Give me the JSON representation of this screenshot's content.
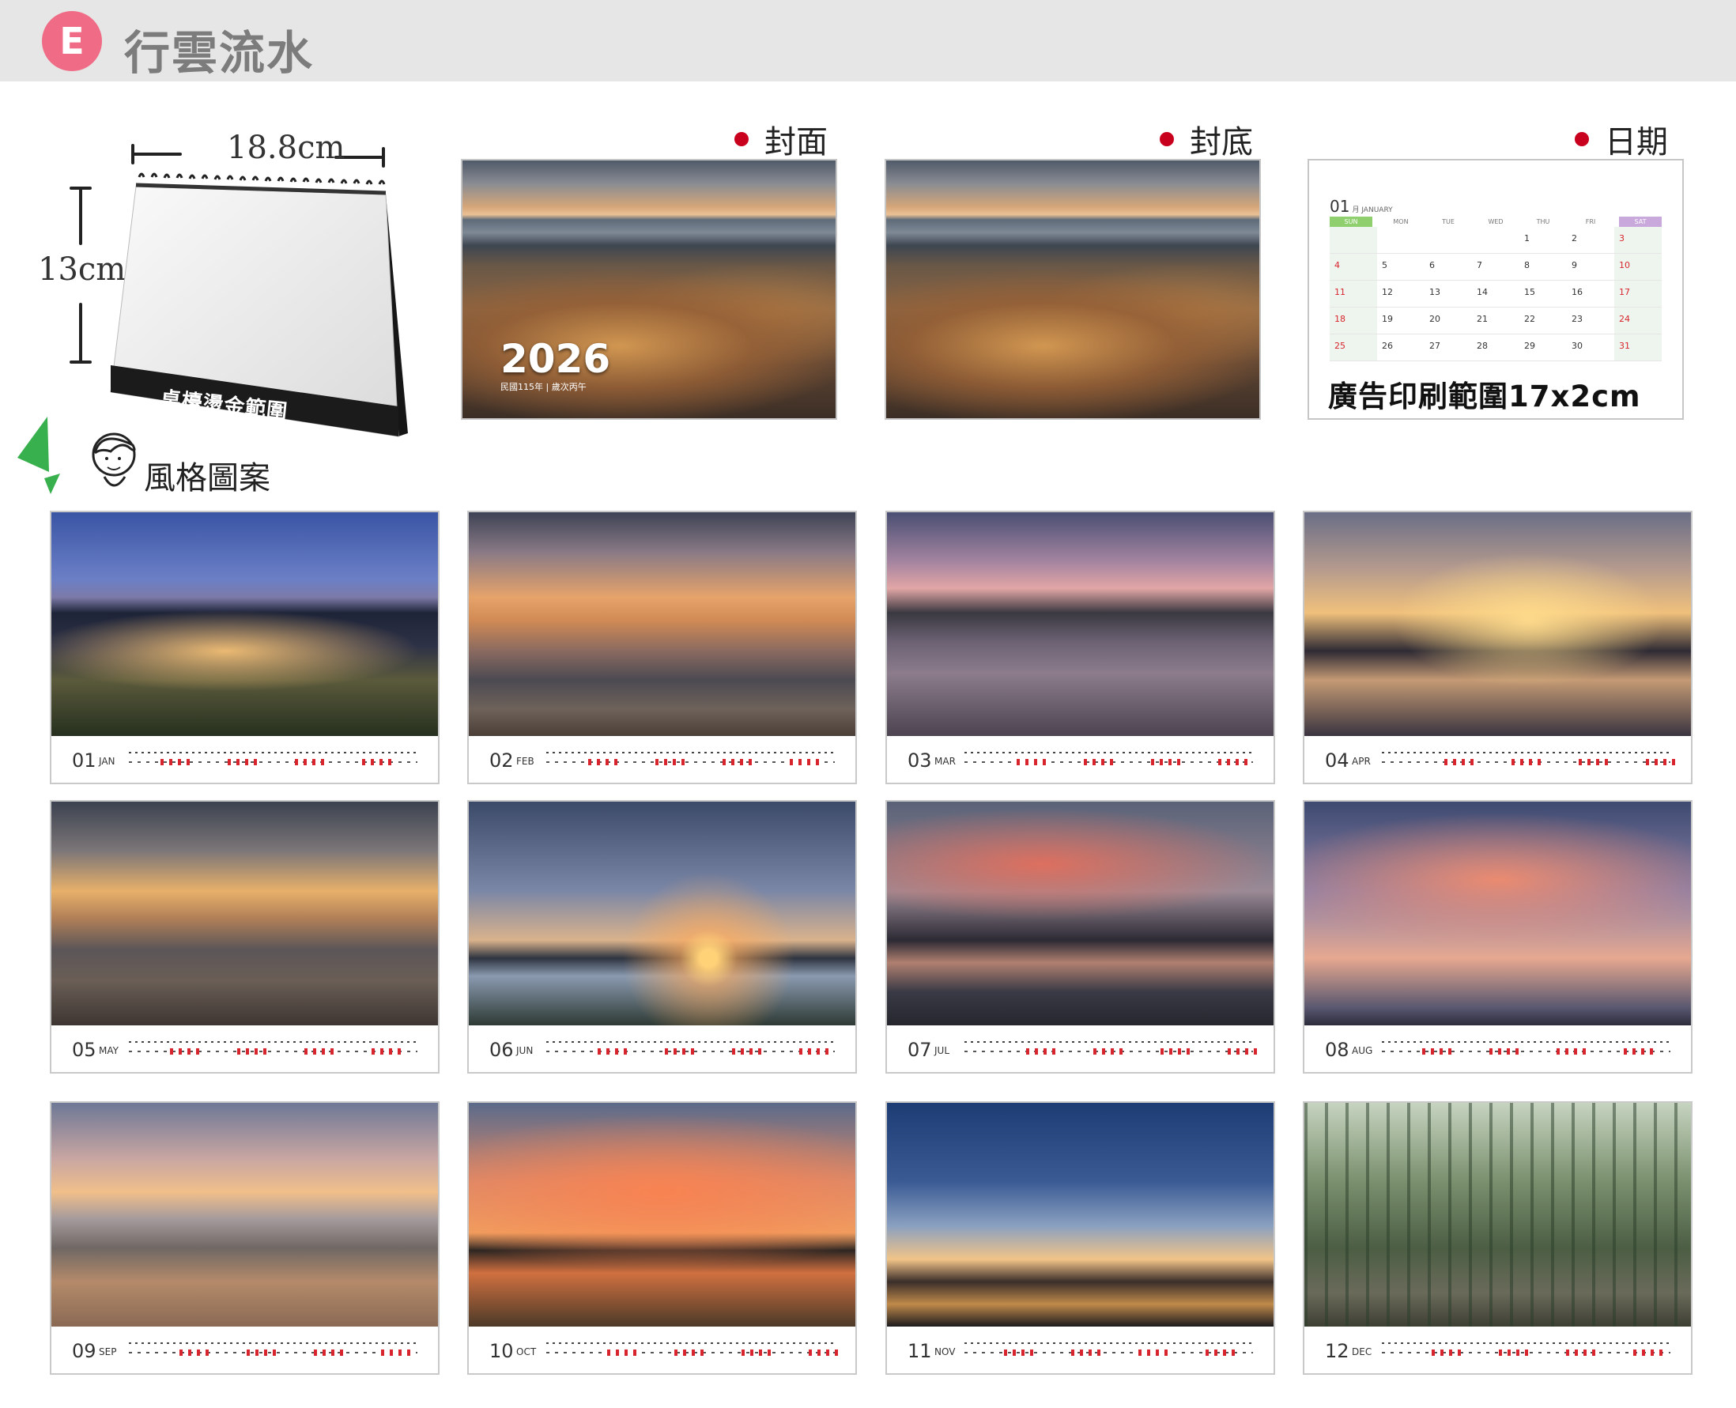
{
  "header": {
    "badge": "E",
    "title": "行雲流水"
  },
  "product": {
    "width_label": "18.8cm",
    "height_label": "13cm",
    "foil_area_label": "桌檯燙金範圍",
    "style_label": "風格圖案"
  },
  "panels": {
    "cover_label": "封面",
    "back_label": "封底",
    "date_label": "日期",
    "cover_year": "2026",
    "cover_sub": "民國115年 | 歲次丙午"
  },
  "date_page": {
    "month": "01",
    "month_name": "月 JANUARY",
    "weekdays": [
      "SUN",
      "MON",
      "TUE",
      "WED",
      "THU",
      "FRI",
      "SAT"
    ],
    "days": [
      [
        "",
        "",
        "",
        "",
        "1",
        "2",
        "3"
      ],
      [
        "4",
        "5",
        "6",
        "7",
        "8",
        "9",
        "10"
      ],
      [
        "11",
        "12",
        "13",
        "14",
        "15",
        "16",
        "17"
      ],
      [
        "18",
        "19",
        "20",
        "21",
        "22",
        "23",
        "24"
      ],
      [
        "25",
        "26",
        "27",
        "28",
        "29",
        "30",
        "31"
      ]
    ],
    "ad_area_label": "廣告印刷範圍17x2cm"
  },
  "months": [
    {
      "num": "01",
      "abbr": "JAN",
      "scene": "city-night"
    },
    {
      "num": "02",
      "abbr": "FEB",
      "scene": "pier-dusk"
    },
    {
      "num": "03",
      "abbr": "MAR",
      "scene": "shore-dusk"
    },
    {
      "num": "04",
      "abbr": "APR",
      "scene": "harbor-sunset"
    },
    {
      "num": "05",
      "abbr": "MAY",
      "scene": "pier-sunset"
    },
    {
      "num": "06",
      "abbr": "JUN",
      "scene": "mountain-sunrise"
    },
    {
      "num": "07",
      "abbr": "JUL",
      "scene": "harbor-clouds"
    },
    {
      "num": "08",
      "abbr": "AUG",
      "scene": "pink-sky"
    },
    {
      "num": "09",
      "abbr": "SEP",
      "scene": "rocky-coast"
    },
    {
      "num": "10",
      "abbr": "OCT",
      "scene": "fiery-sky"
    },
    {
      "num": "11",
      "abbr": "NOV",
      "scene": "taipei-skyline"
    },
    {
      "num": "12",
      "abbr": "DEC",
      "scene": "bamboo-forest"
    }
  ]
}
